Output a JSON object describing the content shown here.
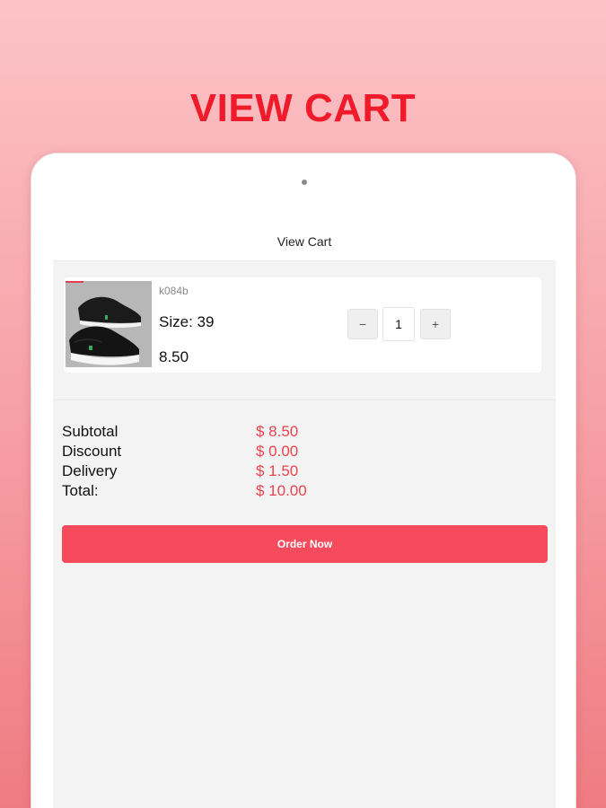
{
  "promo": {
    "title": "VIEW CART"
  },
  "header": {
    "title": "View Cart"
  },
  "cart": {
    "items": [
      {
        "code": "k084b",
        "size": "Size: 39",
        "price": "8.50",
        "quantity": "1",
        "image": "black-sneaker-photo"
      }
    ],
    "qty_minus": "−",
    "qty_plus": "+"
  },
  "summary": {
    "rows": [
      {
        "label": "Subtotal",
        "value": "$ 8.50"
      },
      {
        "label": "Discount",
        "value": "$ 0.00"
      },
      {
        "label": "Delivery",
        "value": "$ 1.50"
      },
      {
        "label": "Total:",
        "value": "$ 10.00"
      }
    ]
  },
  "actions": {
    "order_label": "Order Now"
  },
  "colors": {
    "accent": "#f54b5c",
    "price_red": "#e9434f",
    "promo_red": "#ef1b2a"
  }
}
